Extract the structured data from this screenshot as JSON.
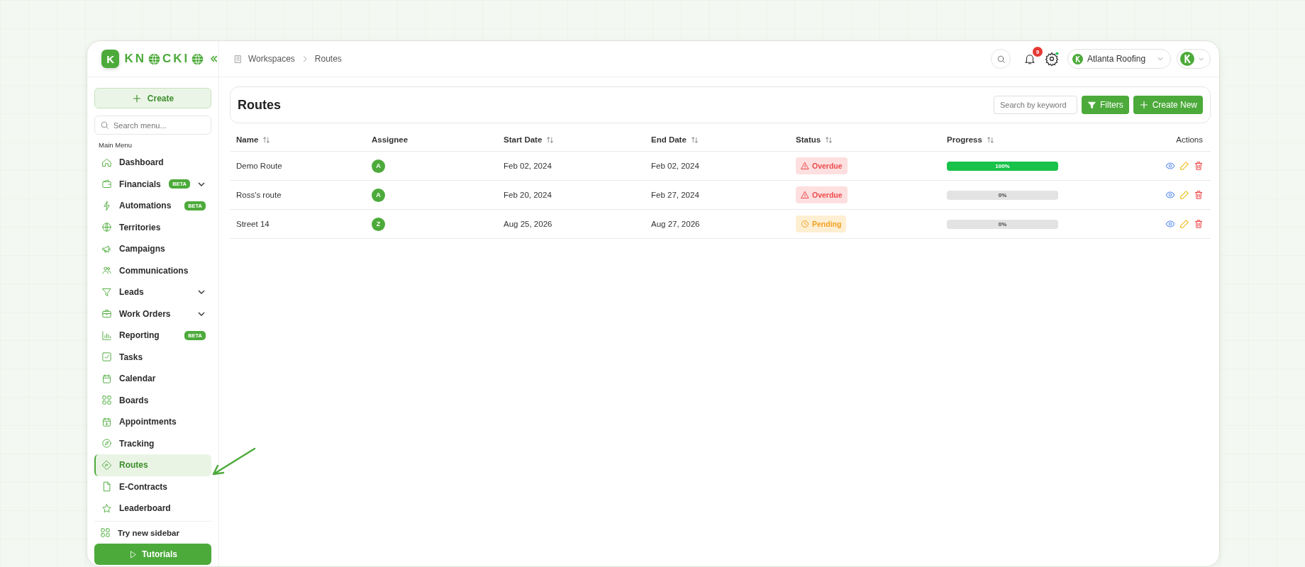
{
  "brand": {
    "mark": "K",
    "parts": [
      "KN",
      "CKI"
    ]
  },
  "sidebar": {
    "create_button": "Create",
    "search": {
      "placeholder": "Search menu..."
    },
    "section_title": "Main Menu",
    "items": [
      {
        "label": "Dashboard",
        "expandable": false,
        "selected": false
      },
      {
        "label": "Financials",
        "badge": "BETA",
        "expandable": true,
        "selected": false
      },
      {
        "label": "Automations",
        "badge": "BETA",
        "expandable": false,
        "selected": false
      },
      {
        "label": "Territories",
        "expandable": false,
        "selected": false
      },
      {
        "label": "Campaigns",
        "expandable": false,
        "selected": false
      },
      {
        "label": "Communications",
        "expandable": false,
        "selected": false
      },
      {
        "label": "Leads",
        "expandable": true,
        "selected": false
      },
      {
        "label": "Work Orders",
        "expandable": true,
        "selected": false
      },
      {
        "label": "Reporting",
        "badge": "BETA",
        "expandable": false,
        "selected": false
      },
      {
        "label": "Tasks",
        "expandable": false,
        "selected": false
      },
      {
        "label": "Calendar",
        "expandable": false,
        "selected": false
      },
      {
        "label": "Boards",
        "expandable": false,
        "selected": false
      },
      {
        "label": "Appointments",
        "expandable": false,
        "selected": false
      },
      {
        "label": "Tracking",
        "expandable": false,
        "selected": false
      },
      {
        "label": "Routes",
        "expandable": false,
        "selected": true
      },
      {
        "label": "E-Contracts",
        "expandable": false,
        "selected": false
      },
      {
        "label": "Leaderboard",
        "expandable": false,
        "selected": false
      }
    ],
    "footer": {
      "link": "Try new sidebar",
      "button": "Tutorials"
    }
  },
  "topbar": {
    "breadcrumb": [
      "Workspaces",
      "Routes"
    ],
    "notification_count": "9",
    "workspace": "Atlanta Roofing"
  },
  "page": {
    "title": "Routes",
    "search": {
      "placeholder": "Search by keyword"
    },
    "filters_button": "Filters",
    "create_button": "Create New"
  },
  "table": {
    "columns": [
      {
        "label": "Name",
        "sortable": true
      },
      {
        "label": "Assignee",
        "sortable": false
      },
      {
        "label": "Start Date",
        "sortable": true
      },
      {
        "label": "End Date",
        "sortable": true
      },
      {
        "label": "Status",
        "sortable": true
      },
      {
        "label": "Progress",
        "sortable": true
      },
      {
        "label": "Actions",
        "sortable": false
      }
    ],
    "rows": [
      {
        "name": "Demo Route",
        "assignee": "A",
        "start_date": "Feb 02, 2024",
        "end_date": "Feb 02, 2024",
        "status": {
          "kind": "overdue",
          "label": "Overdue"
        },
        "progress": {
          "level": 1,
          "label": "100%"
        }
      },
      {
        "name": "Ross's route",
        "assignee": "A",
        "start_date": "Feb 20, 2024",
        "end_date": "Feb 27, 2024",
        "status": {
          "kind": "overdue",
          "label": "Overdue"
        },
        "progress": {
          "level": 0,
          "label": "0%"
        }
      },
      {
        "name": "Street 14",
        "assignee": "Z",
        "start_date": "Aug 25, 2026",
        "end_date": "Aug 27, 2026",
        "status": {
          "kind": "pending",
          "label": "Pending"
        },
        "progress": {
          "level": 0,
          "label": "0%"
        }
      }
    ]
  }
}
